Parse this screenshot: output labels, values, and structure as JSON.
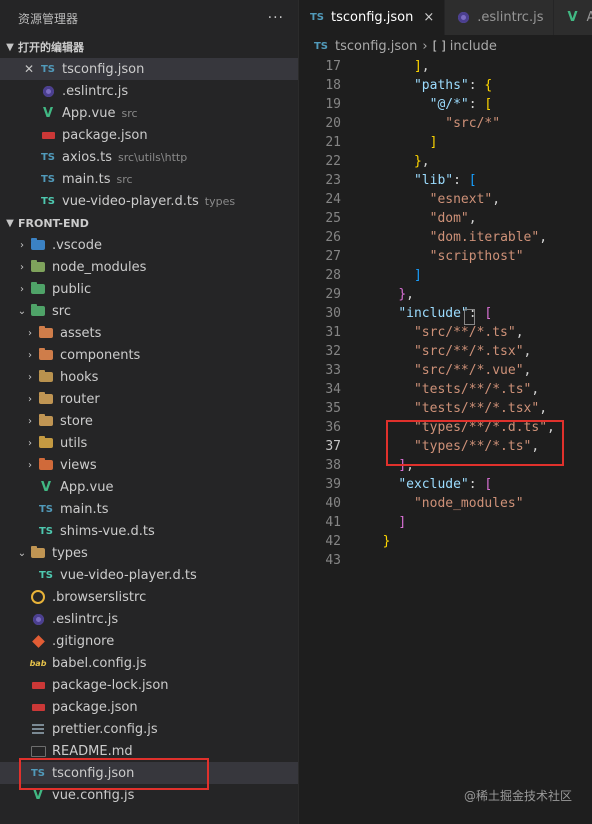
{
  "explorer": {
    "title": "资源管理器",
    "more": "···",
    "open_editors_title": "打开的编辑器",
    "open_editors": [
      {
        "name": "tsconfig.json",
        "desc": "",
        "icon": "tsconfig-icon",
        "active": true
      },
      {
        "name": ".eslintrc.js",
        "desc": "",
        "icon": "eslint-icon"
      },
      {
        "name": "App.vue",
        "desc": "src",
        "icon": "vue-icon"
      },
      {
        "name": "package.json",
        "desc": "",
        "icon": "npm-icon"
      },
      {
        "name": "axios.ts",
        "desc": "src\\utils\\http",
        "icon": "ts-icon"
      },
      {
        "name": "main.ts",
        "desc": "src",
        "icon": "ts-icon"
      },
      {
        "name": "vue-video-player.d.ts",
        "desc": "types",
        "icon": "ts-definition-icon"
      }
    ],
    "project_title": "FRONT-END",
    "tree": [
      {
        "name": ".vscode",
        "icon": "vscode-folder-icon"
      },
      {
        "name": "node_modules",
        "icon": "node-folder-icon"
      },
      {
        "name": "public",
        "icon": "public-folder-icon"
      },
      {
        "name": "src",
        "icon": "src-folder-icon"
      },
      {
        "name": "assets",
        "icon": "assets-folder-icon"
      },
      {
        "name": "components",
        "icon": "components-folder-icon"
      },
      {
        "name": "hooks",
        "icon": "hooks-folder-icon"
      },
      {
        "name": "router",
        "icon": "router-folder-icon"
      },
      {
        "name": "store",
        "icon": "store-folder-icon"
      },
      {
        "name": "utils",
        "icon": "utils-folder-icon"
      },
      {
        "name": "views",
        "icon": "views-folder-icon"
      },
      {
        "name": "App.vue",
        "icon": "vue-icon"
      },
      {
        "name": "main.ts",
        "icon": "ts-icon"
      },
      {
        "name": "shims-vue.d.ts",
        "icon": "ts-definition-icon"
      },
      {
        "name": "types",
        "icon": "folder-icon"
      },
      {
        "name": "vue-video-player.d.ts",
        "icon": "ts-definition-icon"
      },
      {
        "name": ".browserslistrc",
        "icon": "browserslist-icon"
      },
      {
        "name": ".eslintrc.js",
        "icon": "eslint-icon"
      },
      {
        "name": ".gitignore",
        "icon": "git-icon"
      },
      {
        "name": "babel.config.js",
        "icon": "babel-icon"
      },
      {
        "name": "package-lock.json",
        "icon": "npm-icon"
      },
      {
        "name": "package.json",
        "icon": "npm-icon"
      },
      {
        "name": "prettier.config.js",
        "icon": "prettier-icon"
      },
      {
        "name": "README.md",
        "icon": "markdown-icon"
      },
      {
        "name": "tsconfig.json",
        "icon": "tsconfig-icon",
        "selected": true
      },
      {
        "name": "vue.config.js",
        "icon": "vue-config-icon"
      }
    ]
  },
  "tabs": [
    {
      "label": "tsconfig.json",
      "active": true,
      "close": "×"
    },
    {
      "label": ".eslintrc.js"
    },
    {
      "label": "A"
    }
  ],
  "breadcrumb": {
    "file": "tsconfig.json",
    "sep": "›",
    "symbol_icon": "[ ]",
    "symbol": "include"
  },
  "code": {
    "line_numbers": [
      "17",
      "18",
      "19",
      "20",
      "21",
      "22",
      "23",
      "24",
      "25",
      "26",
      "27",
      "28",
      "29",
      "30",
      "31",
      "32",
      "33",
      "34",
      "35",
      "36",
      "37",
      "38",
      "39",
      "40",
      "41",
      "42",
      "43"
    ],
    "current_line": "37",
    "lines": [
      [
        {
          "t": "      ",
          "c": "p"
        },
        {
          "t": "]",
          "c": "b1"
        },
        {
          "t": ",",
          "c": "p"
        }
      ],
      [
        {
          "t": "      ",
          "c": "p"
        },
        {
          "t": "\"paths\"",
          "c": "k"
        },
        {
          "t": ": ",
          "c": "p"
        },
        {
          "t": "{",
          "c": "b1"
        }
      ],
      [
        {
          "t": "        ",
          "c": "p"
        },
        {
          "t": "\"@/*\"",
          "c": "k"
        },
        {
          "t": ": ",
          "c": "p"
        },
        {
          "t": "[",
          "c": "b1"
        }
      ],
      [
        {
          "t": "          ",
          "c": "p"
        },
        {
          "t": "\"src/*\"",
          "c": "s"
        }
      ],
      [
        {
          "t": "        ",
          "c": "p"
        },
        {
          "t": "]",
          "c": "b1"
        }
      ],
      [
        {
          "t": "      ",
          "c": "p"
        },
        {
          "t": "}",
          "c": "b1"
        },
        {
          "t": ",",
          "c": "p"
        }
      ],
      [
        {
          "t": "      ",
          "c": "p"
        },
        {
          "t": "\"lib\"",
          "c": "k"
        },
        {
          "t": ": ",
          "c": "p"
        },
        {
          "t": "[",
          "c": "b3"
        }
      ],
      [
        {
          "t": "        ",
          "c": "p"
        },
        {
          "t": "\"esnext\"",
          "c": "s"
        },
        {
          "t": ",",
          "c": "p"
        }
      ],
      [
        {
          "t": "        ",
          "c": "p"
        },
        {
          "t": "\"dom\"",
          "c": "s"
        },
        {
          "t": ",",
          "c": "p"
        }
      ],
      [
        {
          "t": "        ",
          "c": "p"
        },
        {
          "t": "\"dom.iterable\"",
          "c": "s"
        },
        {
          "t": ",",
          "c": "p"
        }
      ],
      [
        {
          "t": "        ",
          "c": "p"
        },
        {
          "t": "\"scripthost\"",
          "c": "s"
        }
      ],
      [
        {
          "t": "      ",
          "c": "p"
        },
        {
          "t": "]",
          "c": "b3"
        }
      ],
      [
        {
          "t": "    ",
          "c": "p"
        },
        {
          "t": "}",
          "c": "b2"
        },
        {
          "t": ",",
          "c": "p"
        }
      ],
      [
        {
          "t": "    ",
          "c": "p"
        },
        {
          "t": "\"include\"",
          "c": "k"
        },
        {
          "t": ": ",
          "c": "p"
        },
        {
          "t": "[",
          "c": "b2"
        }
      ],
      [
        {
          "t": "      ",
          "c": "p"
        },
        {
          "t": "\"src/**/*.ts\"",
          "c": "s"
        },
        {
          "t": ",",
          "c": "p"
        }
      ],
      [
        {
          "t": "      ",
          "c": "p"
        },
        {
          "t": "\"src/**/*.tsx\"",
          "c": "s"
        },
        {
          "t": ",",
          "c": "p"
        }
      ],
      [
        {
          "t": "      ",
          "c": "p"
        },
        {
          "t": "\"src/**/*.vue\"",
          "c": "s"
        },
        {
          "t": ",",
          "c": "p"
        }
      ],
      [
        {
          "t": "      ",
          "c": "p"
        },
        {
          "t": "\"tests/**/*.ts\"",
          "c": "s"
        },
        {
          "t": ",",
          "c": "p"
        }
      ],
      [
        {
          "t": "      ",
          "c": "p"
        },
        {
          "t": "\"tests/**/*.tsx\"",
          "c": "s"
        },
        {
          "t": ",",
          "c": "p"
        }
      ],
      [
        {
          "t": "      ",
          "c": "p"
        },
        {
          "t": "\"types/**/*.d.ts\"",
          "c": "s"
        },
        {
          "t": ",",
          "c": "p"
        }
      ],
      [
        {
          "t": "      ",
          "c": "p"
        },
        {
          "t": "\"types/**/*.ts\"",
          "c": "s"
        },
        {
          "t": ",",
          "c": "p"
        }
      ],
      [
        {
          "t": "    ",
          "c": "p"
        },
        {
          "t": "]",
          "c": "b2"
        },
        {
          "t": ",",
          "c": "p"
        }
      ],
      [
        {
          "t": "    ",
          "c": "p"
        },
        {
          "t": "\"exclude\"",
          "c": "k"
        },
        {
          "t": ": ",
          "c": "p"
        },
        {
          "t": "[",
          "c": "b2"
        }
      ],
      [
        {
          "t": "      ",
          "c": "p"
        },
        {
          "t": "\"node_modules\"",
          "c": "s"
        }
      ],
      [
        {
          "t": "    ",
          "c": "p"
        },
        {
          "t": "]",
          "c": "b2"
        }
      ],
      [
        {
          "t": "  ",
          "c": "p"
        },
        {
          "t": "}",
          "c": "b1"
        }
      ],
      []
    ]
  },
  "watermark": "@稀土掘金技术社区",
  "colors": {
    "highlight": "#e0312c",
    "selection": "#37373d"
  }
}
